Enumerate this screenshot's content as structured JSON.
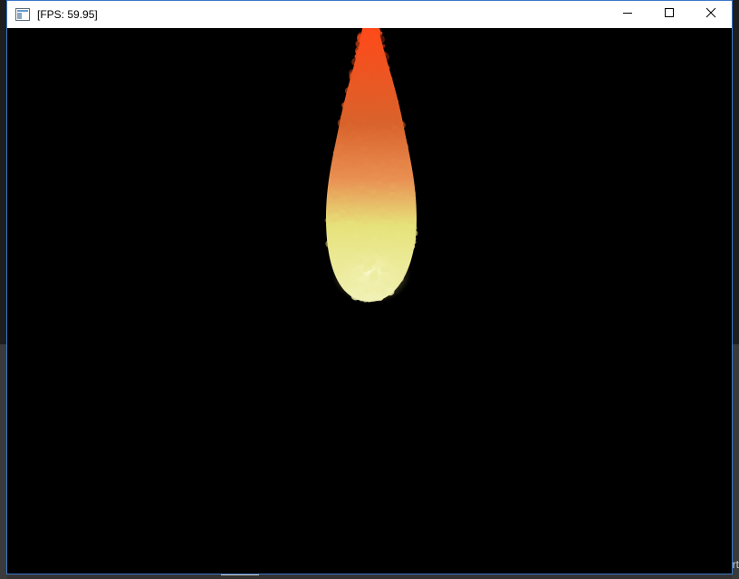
{
  "window": {
    "title": "[FPS: 59.95]"
  },
  "titlebar": {
    "minimize_icon": "minimize-icon",
    "maximize_icon": "maximize-icon",
    "close_icon": "close-icon",
    "app_icon": "window-app-icon"
  },
  "desktop": {
    "edge_text": "rt"
  },
  "colors": {
    "canvas_background": "#000000",
    "flame_top": "#ff4a1a",
    "flame_mid": "#e9874a",
    "flame_low": "#eef08a",
    "window_border": "#3c78c8"
  }
}
